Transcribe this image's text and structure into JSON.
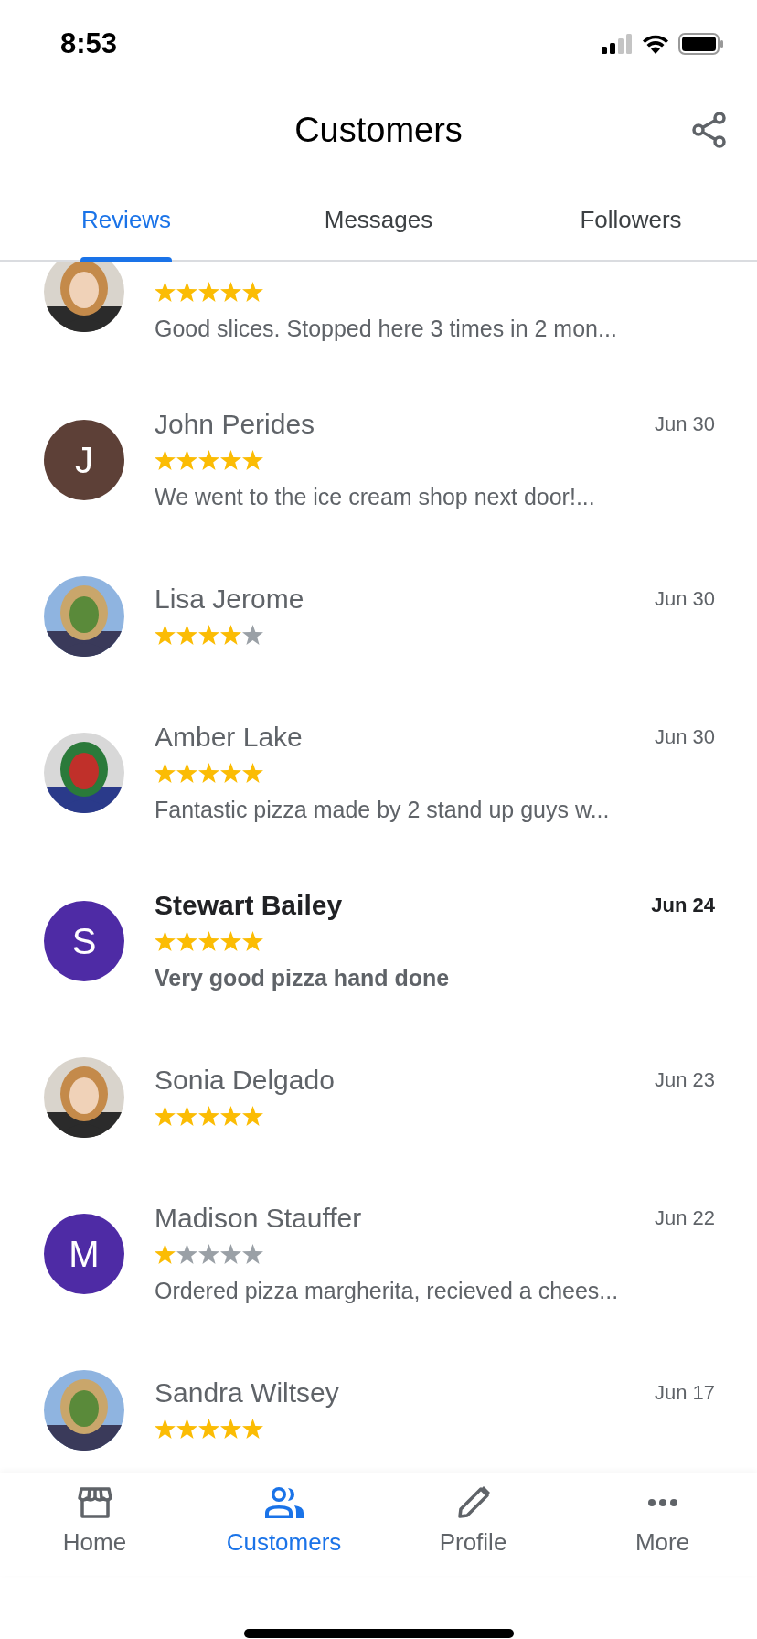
{
  "status_bar": {
    "time": "8:53"
  },
  "header": {
    "title": "Customers"
  },
  "tabs": [
    {
      "label": "Reviews",
      "selected": true
    },
    {
      "label": "Messages",
      "selected": false
    },
    {
      "label": "Followers",
      "selected": false
    }
  ],
  "reviews": [
    {
      "stars": 5,
      "text": "Good slices. Stopped here 3 times in 2 mon...",
      "unread": false
    },
    {
      "avatar": {
        "kind": "letter",
        "letter": "J",
        "color": "#5d4037"
      },
      "name": "John Perides",
      "date": "Jun 30",
      "stars": 5,
      "text": "We went to the ice cream shop next door!...",
      "unread": false
    },
    {
      "name": "Lisa Jerome",
      "date": "Jun 30",
      "stars": 4,
      "unread": false
    },
    {
      "name": "Amber Lake",
      "date": "Jun 30",
      "stars": 5,
      "text": "Fantastic pizza made by 2 stand up guys w...",
      "unread": false
    },
    {
      "avatar": {
        "kind": "letter",
        "letter": "S",
        "color": "#4e2ba5"
      },
      "name": "Stewart Bailey",
      "date": "Jun 24",
      "stars": 5,
      "text": "Very good pizza hand done",
      "unread": true
    },
    {
      "name": "Sonia Delgado",
      "date": "Jun 23",
      "stars": 5,
      "unread": false
    },
    {
      "avatar": {
        "kind": "letter",
        "letter": "M",
        "color": "#4e2ba5"
      },
      "name": "Madison Stauffer",
      "date": "Jun 22",
      "stars": 1,
      "text": "Ordered pizza margherita, recieved a chees...",
      "unread": false
    },
    {
      "name": "Sandra Wiltsey",
      "date": "Jun 17",
      "stars": 5,
      "unread": false
    }
  ],
  "bottom_nav": [
    {
      "label": "Home",
      "selected": false
    },
    {
      "label": "Customers",
      "selected": true
    },
    {
      "label": "Profile",
      "selected": false
    },
    {
      "label": "More",
      "selected": false
    }
  ]
}
